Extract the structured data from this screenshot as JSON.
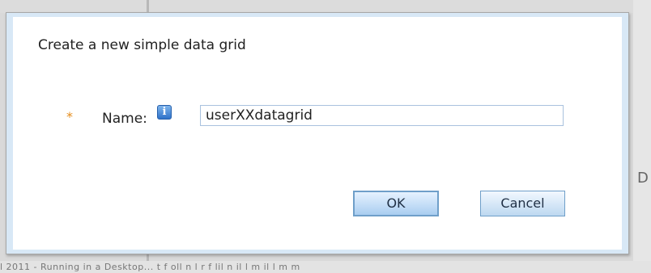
{
  "dialog": {
    "title": "Create a new simple data grid",
    "required_marker": "*",
    "name_label": "Name:",
    "info_icon_glyph": "i",
    "name_value": "userXXdatagrid",
    "ok_label": "OK",
    "cancel_label": "Cancel"
  },
  "background": {
    "bottom_text": "l 2011 - Running in a Desktop...  t  f  oll  n  l  r  f  lil  n  il  l  m  il  l  m  m",
    "right_letter": "D"
  },
  "colors": {
    "accent": "#d8e8f6",
    "required": "#e58c1a",
    "button_border": "#6f9fc9"
  }
}
